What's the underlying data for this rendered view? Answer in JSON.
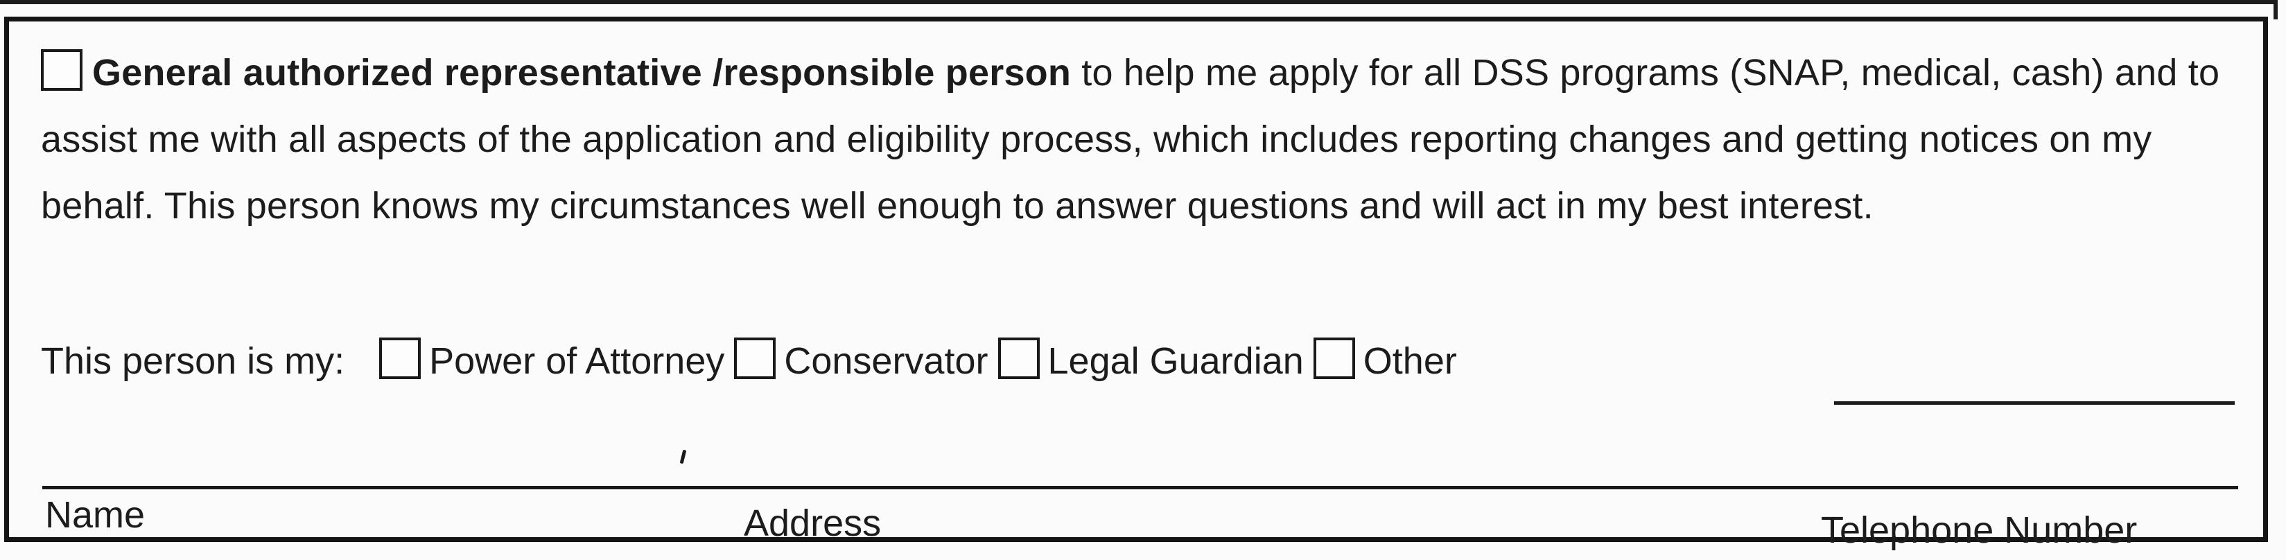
{
  "authorization": {
    "title_bold": "General authorized representative /responsible person",
    "description": " to help me apply for all DSS programs (SNAP, medical, cash) and to assist me with all aspects of the application and eligibility process, which includes reporting changes and getting notices on my behalf.  This person knows my circumstances well enough to answer questions and will act in my best interest."
  },
  "relationship": {
    "prompt": "This person is my:",
    "options": [
      {
        "label": "Power of Attorney",
        "checked": false
      },
      {
        "label": "Conservator",
        "checked": false
      },
      {
        "label": "Legal Guardian",
        "checked": false
      },
      {
        "label": "Other",
        "checked": false
      }
    ],
    "other_value": ""
  },
  "fields": {
    "name_label": "Name",
    "address_label": "Address",
    "phone_label": "Telephone Number",
    "name_value": "",
    "address_value": "",
    "phone_value": ""
  }
}
